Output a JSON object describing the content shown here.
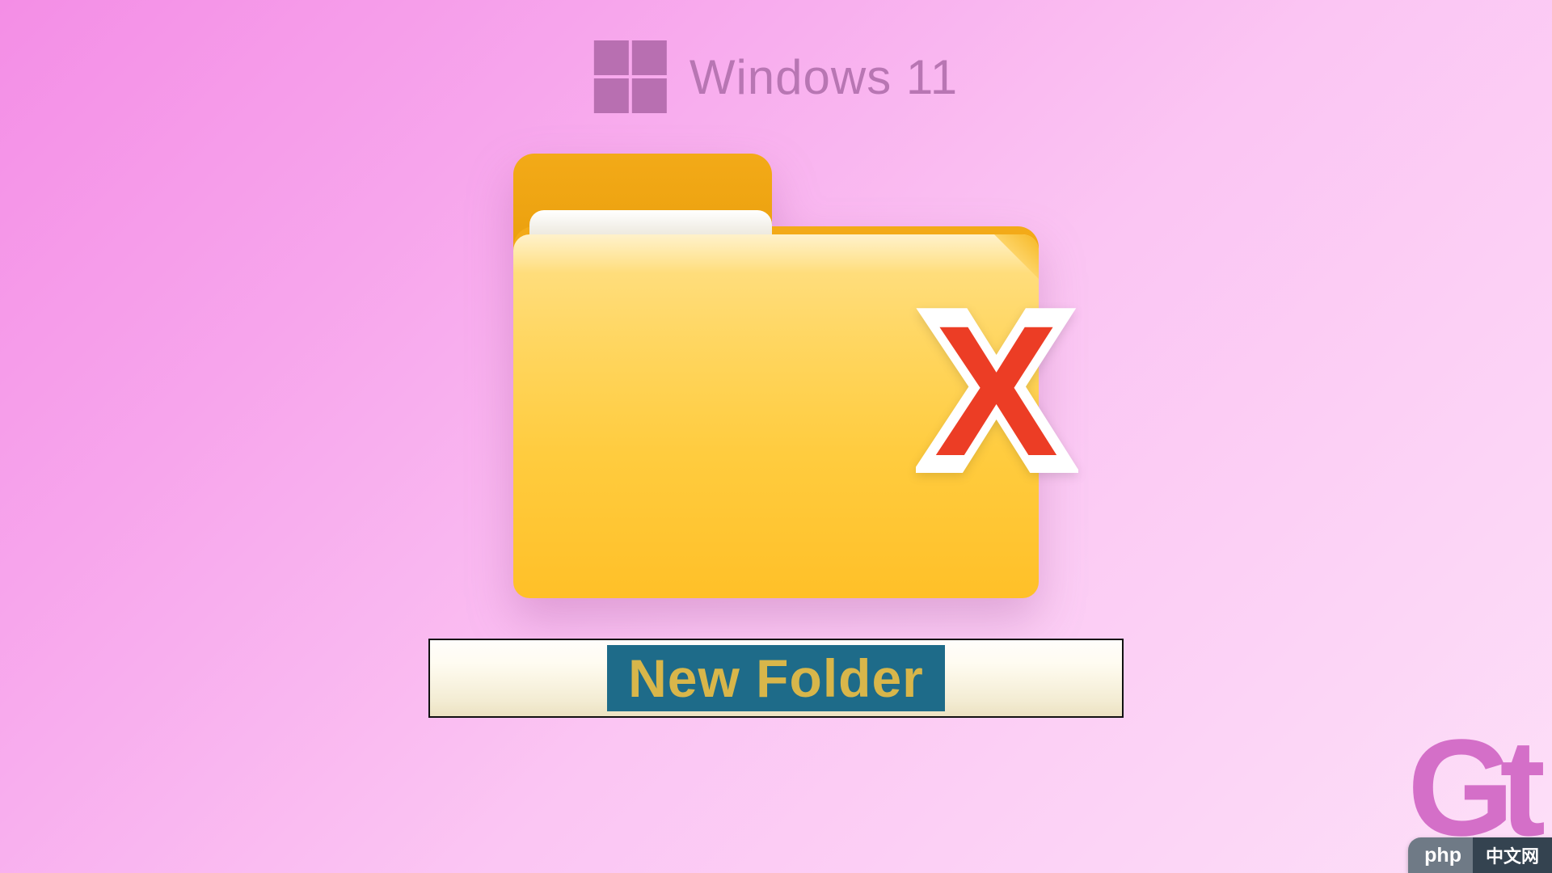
{
  "header": {
    "os_label": "Windows 11"
  },
  "folder": {
    "rename_text": "New Folder"
  },
  "brand": {
    "gt_text": "Gt"
  },
  "watermark": {
    "php_label": "php",
    "cn_label": "中文网"
  }
}
